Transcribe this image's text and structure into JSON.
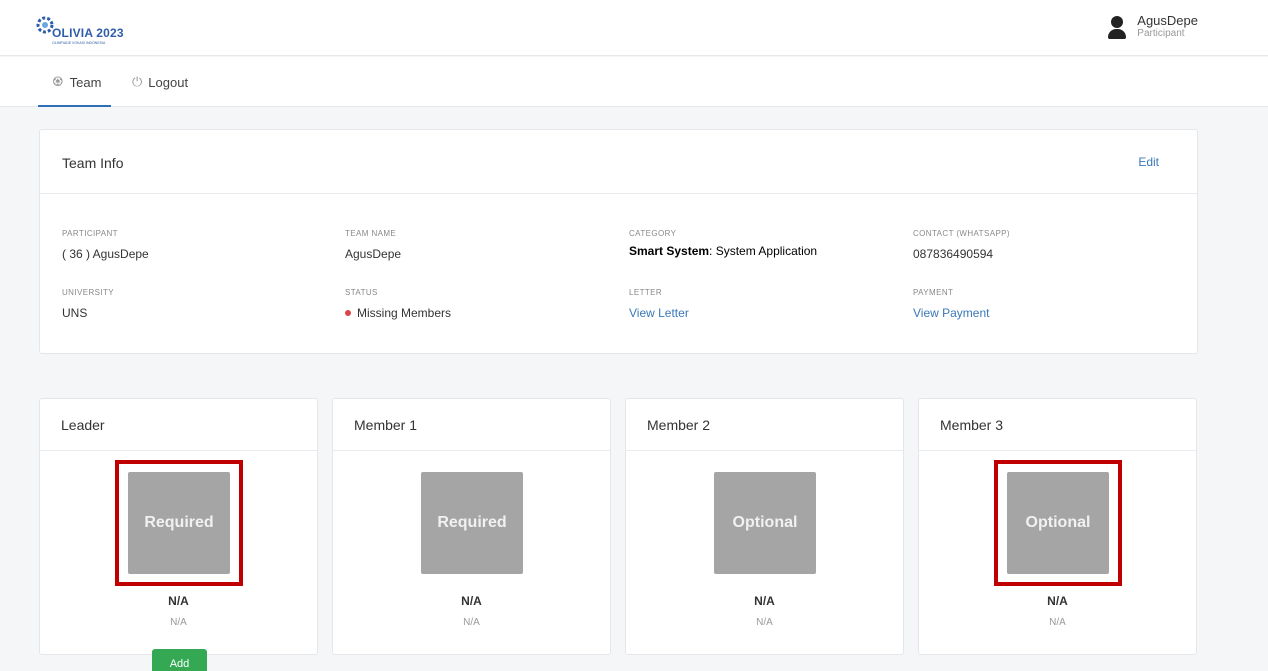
{
  "header": {
    "logo_text": "OLIVIA 2023",
    "logo_sub": "OLIMPIADE VOKASI INDONESIA",
    "user_name": "AgusDepe",
    "user_role": "Participant"
  },
  "nav": {
    "team_label": "Team",
    "logout_label": "Logout"
  },
  "team_info": {
    "title": "Team Info",
    "edit_label": "Edit",
    "fields": {
      "participant": {
        "label": "PARTICIPANT",
        "value": "( 36 ) AgusDepe"
      },
      "team_name": {
        "label": "TEAM NAME",
        "value": "AgusDepe"
      },
      "category": {
        "label": "CATEGORY",
        "value_bold": "Smart System",
        "value_rest": ": System Application"
      },
      "contact": {
        "label": "CONTACT (WHATSAPP)",
        "value": "087836490594"
      },
      "university": {
        "label": "UNIVERSITY",
        "value": "UNS"
      },
      "status": {
        "label": "STATUS",
        "value": "Missing Members"
      },
      "letter": {
        "label": "LETTER",
        "value": "View Letter"
      },
      "payment": {
        "label": "PAYMENT",
        "value": "View Payment"
      }
    }
  },
  "members": [
    {
      "title": "Leader",
      "photo_label": "Required",
      "name": "N/A",
      "sub": "N/A",
      "add_label": "Add"
    },
    {
      "title": "Member 1",
      "photo_label": "Required",
      "name": "N/A",
      "sub": "N/A"
    },
    {
      "title": "Member 2",
      "photo_label": "Optional",
      "name": "N/A",
      "sub": "N/A"
    },
    {
      "title": "Member 3",
      "photo_label": "Optional",
      "name": "N/A",
      "sub": "N/A"
    }
  ],
  "colors": {
    "accent": "#2f6fb8",
    "link": "#3a78b8",
    "status_dot": "#d9464a",
    "add_button": "#34a853",
    "highlight": "#c00000"
  }
}
